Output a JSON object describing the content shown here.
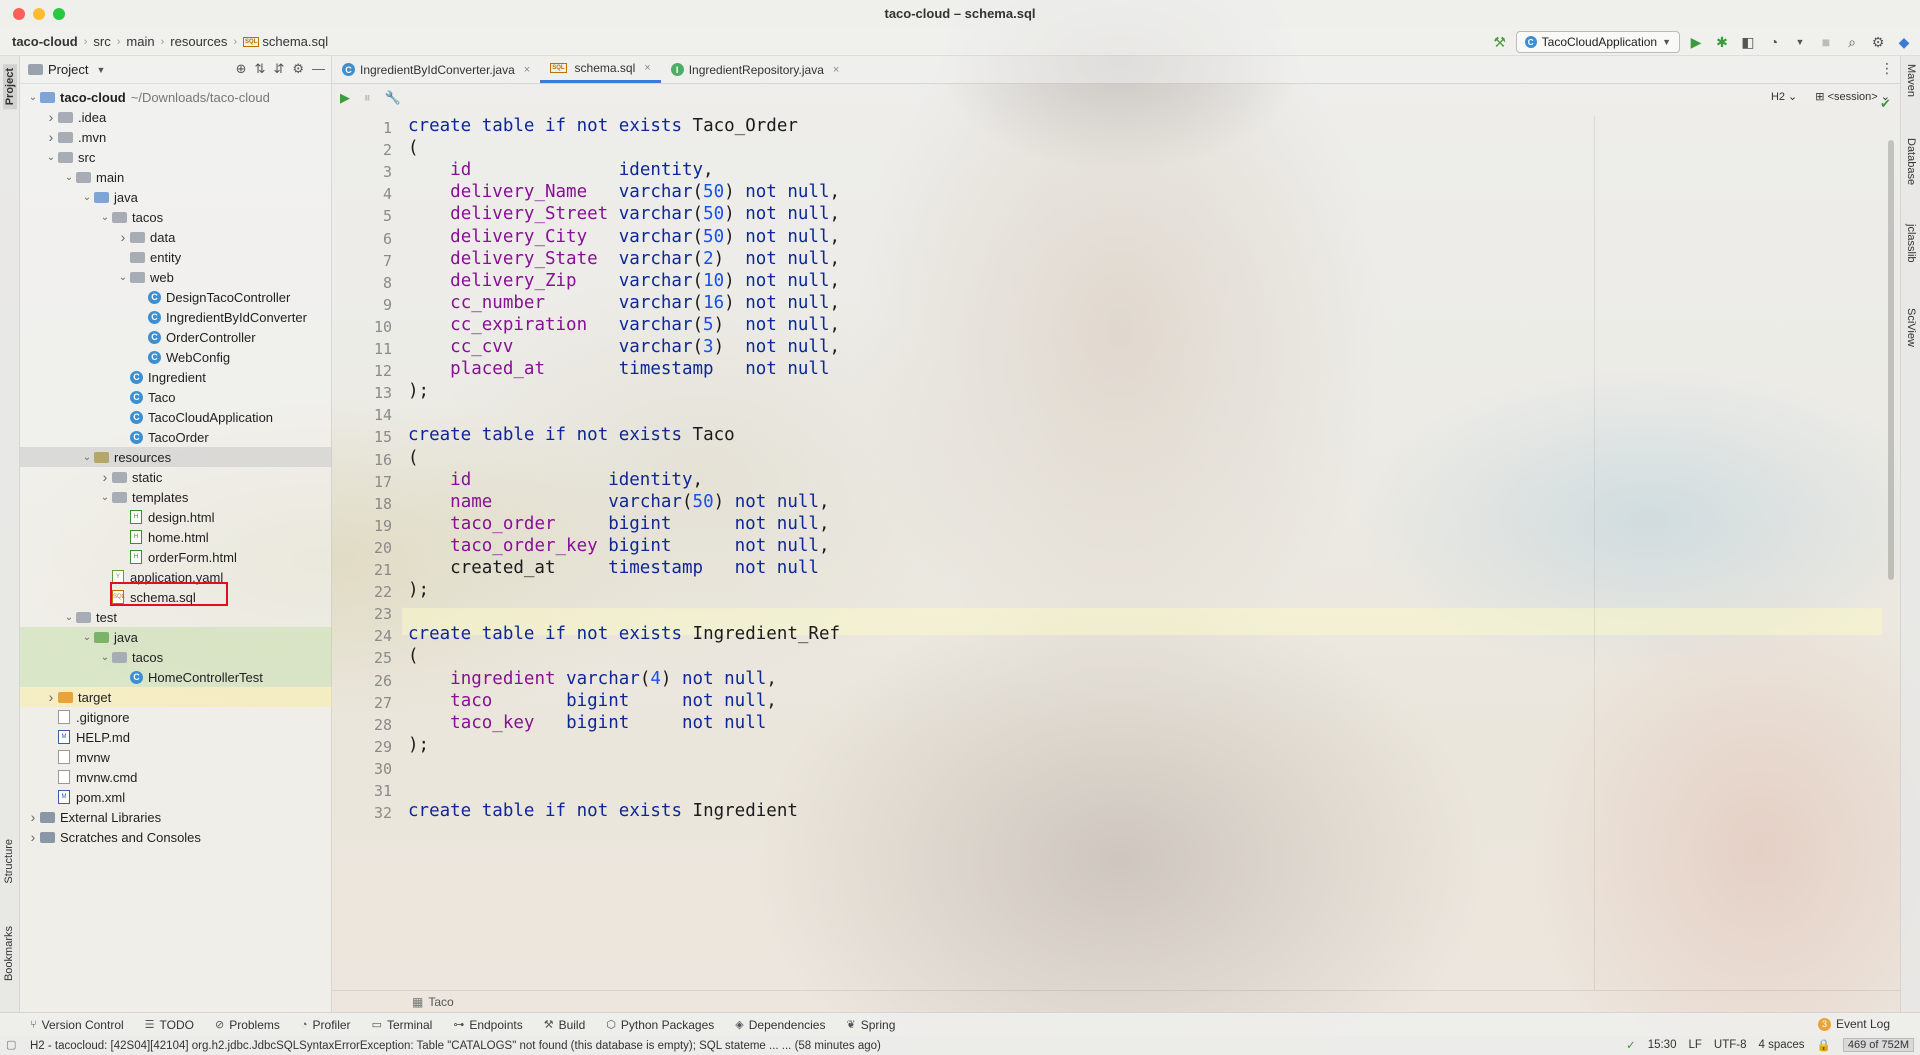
{
  "window": {
    "title": "taco-cloud – schema.sql"
  },
  "breadcrumb": [
    "taco-cloud",
    "src",
    "main",
    "resources",
    "schema.sql"
  ],
  "run_config": {
    "label": "TacoCloudApplication"
  },
  "left_stripe": {
    "project_label": "Project",
    "structure_label": "Structure",
    "bookmarks_label": "Bookmarks"
  },
  "right_stripe": {
    "maven": "Maven",
    "database": "Database",
    "jclasslib": "jclasslib",
    "sciview": "SciView"
  },
  "project_panel": {
    "title": "Project",
    "tree": [
      {
        "label": "taco-cloud",
        "extra": "~/Downloads/taco-cloud",
        "kind": "module",
        "level": 0,
        "open": true
      },
      {
        "label": ".idea",
        "kind": "folder",
        "level": 1,
        "open": false
      },
      {
        "label": ".mvn",
        "kind": "folder",
        "level": 1,
        "open": false
      },
      {
        "label": "src",
        "kind": "folder",
        "level": 1,
        "open": true
      },
      {
        "label": "main",
        "kind": "folder",
        "level": 2,
        "open": true
      },
      {
        "label": "java",
        "kind": "blue",
        "level": 3,
        "open": true
      },
      {
        "label": "tacos",
        "kind": "folder",
        "level": 4,
        "open": true
      },
      {
        "label": "data",
        "kind": "folder",
        "level": 5,
        "open": false
      },
      {
        "label": "entity",
        "kind": "folder",
        "level": 5,
        "leaf": true
      },
      {
        "label": "web",
        "kind": "folder",
        "level": 5,
        "open": true
      },
      {
        "label": "DesignTacoController",
        "kind": "class",
        "level": 6,
        "leaf": true
      },
      {
        "label": "IngredientByIdConverter",
        "kind": "class",
        "level": 6,
        "leaf": true
      },
      {
        "label": "OrderController",
        "kind": "class",
        "level": 6,
        "leaf": true
      },
      {
        "label": "WebConfig",
        "kind": "class",
        "level": 6,
        "leaf": true
      },
      {
        "label": "Ingredient",
        "kind": "class",
        "level": 5,
        "leaf": true
      },
      {
        "label": "Taco",
        "kind": "class",
        "level": 5,
        "leaf": true
      },
      {
        "label": "TacoCloudApplication",
        "kind": "class",
        "level": 5,
        "leaf": true
      },
      {
        "label": "TacoOrder",
        "kind": "class",
        "level": 5,
        "leaf": true
      },
      {
        "label": "resources",
        "kind": "res",
        "level": 3,
        "open": true,
        "selected": true
      },
      {
        "label": "static",
        "kind": "folder",
        "level": 4,
        "open": false
      },
      {
        "label": "templates",
        "kind": "folder",
        "level": 4,
        "open": true
      },
      {
        "label": "design.html",
        "kind": "html",
        "level": 5,
        "leaf": true
      },
      {
        "label": "home.html",
        "kind": "html",
        "level": 5,
        "leaf": true
      },
      {
        "label": "orderForm.html",
        "kind": "html",
        "level": 5,
        "leaf": true
      },
      {
        "label": "application.yaml",
        "kind": "yml",
        "level": 4,
        "leaf": true
      },
      {
        "label": "schema.sql",
        "kind": "sql",
        "level": 4,
        "leaf": true
      },
      {
        "label": "test",
        "kind": "folder",
        "level": 2,
        "open": true
      },
      {
        "label": "java",
        "kind": "test",
        "level": 3,
        "open": true,
        "testrow": true
      },
      {
        "label": "tacos",
        "kind": "folder",
        "level": 4,
        "open": true,
        "testrow": true
      },
      {
        "label": "HomeControllerTest",
        "kind": "class",
        "level": 5,
        "leaf": true,
        "testrow": true
      },
      {
        "label": "target",
        "kind": "tgt",
        "level": 1,
        "open": false,
        "tgtrow": true
      },
      {
        "label": ".gitignore",
        "kind": "file",
        "level": 1,
        "leaf": true
      },
      {
        "label": "HELP.md",
        "kind": "md",
        "level": 1,
        "leaf": true
      },
      {
        "label": "mvnw",
        "kind": "file",
        "level": 1,
        "leaf": true
      },
      {
        "label": "mvnw.cmd",
        "kind": "file",
        "level": 1,
        "leaf": true
      },
      {
        "label": "pom.xml",
        "kind": "md",
        "level": 1,
        "leaf": true
      },
      {
        "label": "External Libraries",
        "kind": "lib",
        "level": 0,
        "open": false
      },
      {
        "label": "Scratches and Consoles",
        "kind": "lib",
        "level": 0,
        "open": false
      }
    ]
  },
  "tabs": [
    {
      "label": "IngredientByIdConverter.java",
      "icon": "class-icon",
      "active": false
    },
    {
      "label": "schema.sql",
      "icon": "sql-icon",
      "active": true
    },
    {
      "label": "IngredientRepository.java",
      "icon": "interface-icon",
      "active": false
    }
  ],
  "editor_toolbar": {
    "dialect": "H2",
    "session": "<session>"
  },
  "code_lines": [
    "create table if not exists Taco_Order",
    "(",
    "    id              identity,",
    "    delivery_Name   varchar(50) not null,",
    "    delivery_Street varchar(50) not null,",
    "    delivery_City   varchar(50) not null,",
    "    delivery_State  varchar(2)  not null,",
    "    delivery_Zip    varchar(10) not null,",
    "    cc_number       varchar(16) not null,",
    "    cc_expiration   varchar(5)  not null,",
    "    cc_cvv          varchar(3)  not null,",
    "    placed_at       timestamp   not null",
    ");",
    "",
    "create table if not exists Taco",
    "(",
    "    id             identity,",
    "    name           varchar(50) not null,",
    "    taco_order     bigint      not null,",
    "    taco_order_key bigint      not null,",
    "    created_at     timestamp   not null",
    ");",
    "",
    "create table if not exists Ingredient_Ref",
    "(",
    "    ingredient varchar(4) not null,",
    "    taco       bigint     not null,",
    "    taco_key   bigint     not null",
    ");",
    "",
    "",
    "create table if not exists Ingredient"
  ],
  "editor_breadcrumb": "Taco",
  "tool_windows": [
    {
      "label": "Version Control",
      "icon": "git-branch-icon"
    },
    {
      "label": "TODO",
      "icon": "list-icon"
    },
    {
      "label": "Problems",
      "icon": "problems-icon"
    },
    {
      "label": "Profiler",
      "icon": "profiler-icon"
    },
    {
      "label": "Terminal",
      "icon": "terminal-icon"
    },
    {
      "label": "Endpoints",
      "icon": "endpoints-icon"
    },
    {
      "label": "Build",
      "icon": "hammer-icon"
    },
    {
      "label": "Python Packages",
      "icon": "packages-icon"
    },
    {
      "label": "Dependencies",
      "icon": "dependencies-icon"
    },
    {
      "label": "Spring",
      "icon": "spring-icon"
    }
  ],
  "event_log": {
    "count": "3",
    "label": "Event Log"
  },
  "status": {
    "message": "H2 - tacocloud: [42S04][42104] org.h2.jdbc.JdbcSQLSyntaxErrorException: Table \"CATALOGS\" not found (this database is empty); SQL stateme ... ... (58 minutes ago)",
    "position": "15:30",
    "line_sep": "LF",
    "encoding": "UTF-8",
    "indent": "4 spaces",
    "memory": "469 of 752M"
  },
  "colors": {
    "accent": "#3d7ad6",
    "keyword": "#0d2796",
    "field": "#871094",
    "number": "#1750eb",
    "highlight_box": "#e0101e"
  }
}
